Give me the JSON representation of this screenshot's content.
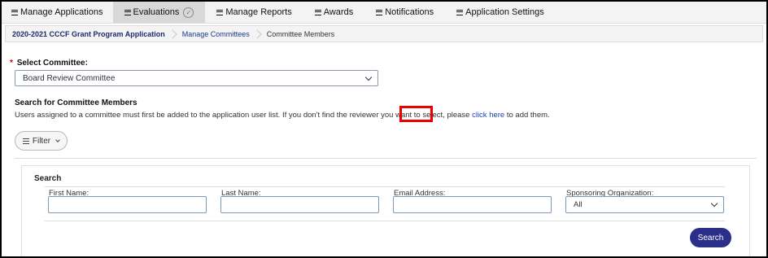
{
  "nav": {
    "items": [
      {
        "label": "Manage Applications"
      },
      {
        "label": "Evaluations"
      },
      {
        "label": "Manage Reports"
      },
      {
        "label": "Awards"
      },
      {
        "label": "Notifications"
      },
      {
        "label": "Application Settings"
      }
    ]
  },
  "breadcrumb": [
    {
      "label": "2020-2021 CCCF Grant Program Application"
    },
    {
      "label": "Manage Committees"
    },
    {
      "label": "Committee Members"
    }
  ],
  "committee": {
    "required_marker": "*",
    "label": "Select Committee:",
    "selected": "Board Review Committee"
  },
  "members": {
    "title": "Search for Committee Members",
    "help_before": "Users assigned to a committee must first be added to the application user list. If you don't find the reviewer you want to select, please ",
    "help_link": "click here",
    "help_after": " to add them."
  },
  "filter": {
    "label": "Filter"
  },
  "search": {
    "title": "Search",
    "fields": {
      "first_name": {
        "label": "First Name:",
        "value": ""
      },
      "last_name": {
        "label": "Last Name:",
        "value": ""
      },
      "email": {
        "label": "Email Address:",
        "value": ""
      },
      "sponsoring_org": {
        "label": "Sponsoring Organization:",
        "selected": "All"
      }
    },
    "button_label": "Search"
  },
  "colors": {
    "highlight": "#ee0000",
    "primary_button": "#2b2f8a",
    "link": "#1f3fb0"
  }
}
